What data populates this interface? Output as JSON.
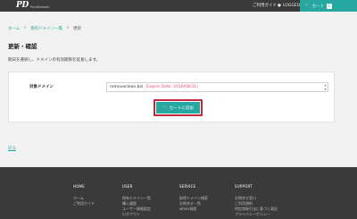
{
  "header": {
    "logo_mark": "PD",
    "logo_text": "PureDomain",
    "guide_label": "ご利用ガイド",
    "user_label": "LOGGED",
    "cart_label": "カート",
    "cart_count": "1",
    "colors": {
      "bar": "#3a3a3a",
      "accent": "#26a7a0"
    }
  },
  "breadcrumb": [
    "ホーム",
    "保有ドメイン一覧",
    "更新"
  ],
  "page": {
    "title": "更新・確認",
    "description": "期日を選択し、ドメインの有効期限を延長します。"
  },
  "form": {
    "field_label": "対象ドメイン",
    "domain_name": "removeclean.biz",
    "expire_text": "(Expire Date: 2016/08/31)",
    "cart_button": "カートに追加",
    "highlight_color": "#c0283a"
  },
  "back_link": "戻る",
  "footer": {
    "columns": [
      {
        "heading": "HOME",
        "items": [
          "ホーム",
          "ご利用ガイド"
        ]
      },
      {
        "heading": "USER",
        "items": [
          "保有ドメイン一覧",
          "購入履歴",
          "ユーザー情報設定",
          "ログアウト"
        ]
      },
      {
        "heading": "SERVICE",
        "items": [
          "取得ドメイン検索",
          "お問合せ一覧",
          "whois検索"
        ]
      },
      {
        "heading": "SUPPORT",
        "items": [
          "お問合せ窓口",
          "ご利用規約",
          "特定商取引法に基づく表記",
          "プライバシーポリシー"
        ]
      }
    ]
  }
}
